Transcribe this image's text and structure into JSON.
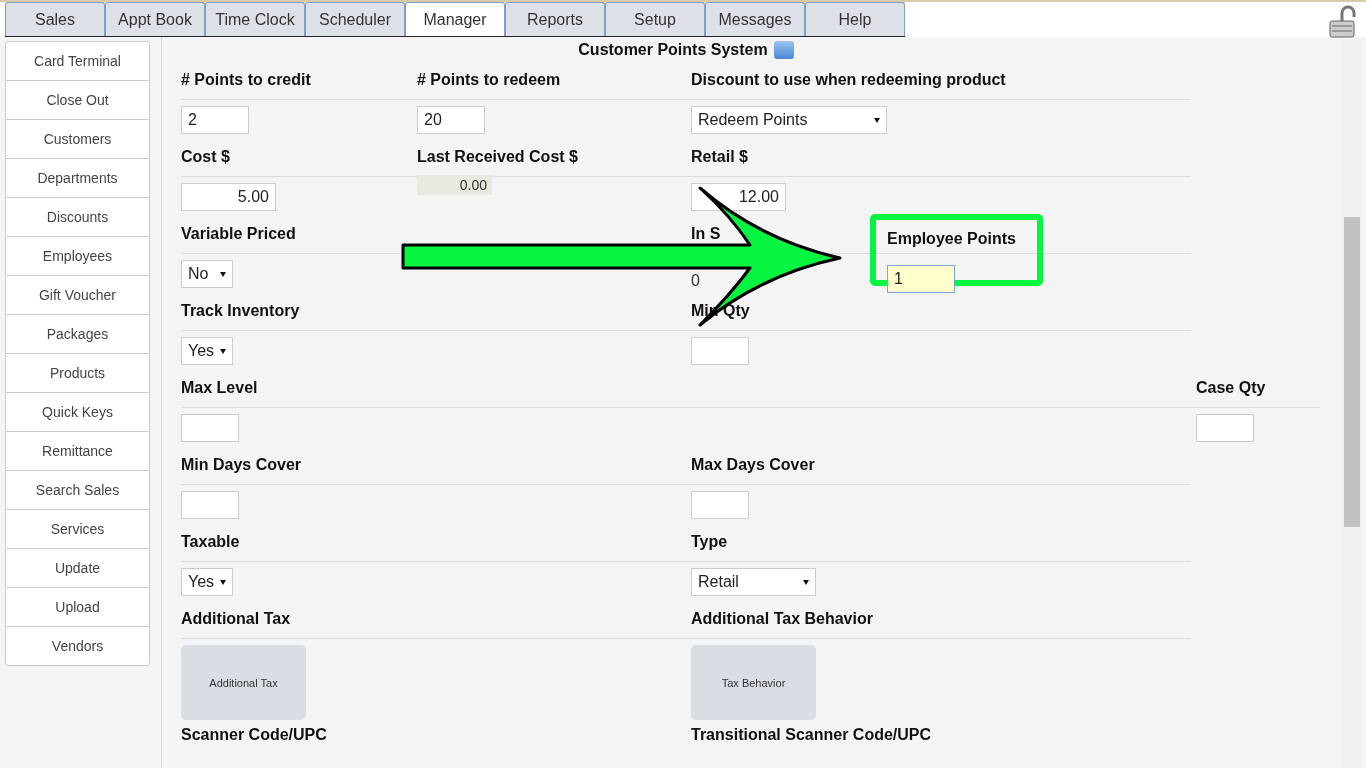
{
  "tabs": [
    {
      "label": "Sales",
      "selected": false
    },
    {
      "label": "Appt Book",
      "selected": false
    },
    {
      "label": "Time Clock",
      "selected": false
    },
    {
      "label": "Scheduler",
      "selected": false
    },
    {
      "label": "Manager",
      "selected": true
    },
    {
      "label": "Reports",
      "selected": false
    },
    {
      "label": "Setup",
      "selected": false
    },
    {
      "label": "Messages",
      "selected": false
    },
    {
      "label": "Help",
      "selected": false
    }
  ],
  "sidebar": {
    "items": [
      "Card Terminal",
      "Close Out",
      "Customers",
      "Departments",
      "Discounts",
      "Employees",
      "Gift Voucher",
      "Packages",
      "Products",
      "Quick Keys",
      "Remittance",
      "Search Sales",
      "Services",
      "Update",
      "Upload",
      "Vendors"
    ]
  },
  "form": {
    "title": "Customer Points System",
    "rows": [
      {
        "fields": [
          {
            "label": "# Points to credit",
            "kind": "input",
            "value": "2",
            "highlighted": false
          },
          {
            "label": "# Points to redeem",
            "kind": "input",
            "value": "20",
            "highlighted": false
          },
          {
            "label": "Discount to use when redeeming product",
            "kind": "select",
            "value": "Redeem Points",
            "highlighted": false
          }
        ]
      },
      {
        "fields": [
          {
            "label": "Cost $",
            "kind": "money",
            "value": "5.00",
            "highlighted": false
          },
          {
            "label": "Last Received Cost $",
            "kind": "readonly",
            "value": "0.00",
            "highlighted": false
          },
          {
            "label": "Retail $",
            "kind": "money",
            "value": "12.00",
            "highlighted": false
          }
        ]
      },
      {
        "fields": [
          {
            "label": "Variable Priced",
            "kind": "select",
            "value": "No",
            "highlighted": false
          },
          {
            "label": "In S",
            "kind": "plain",
            "value": "0",
            "highlighted": false
          },
          {
            "label": "Employee Points",
            "kind": "input",
            "value": "1",
            "highlighted": true
          }
        ]
      },
      {
        "fields": [
          {
            "label": "Track Inventory",
            "kind": "select",
            "value": "Yes",
            "highlighted": false
          },
          {
            "label": "Min Qty",
            "kind": "input",
            "highlighted": false
          }
        ]
      },
      {
        "fields": [
          {
            "label": "Max Level",
            "kind": "input",
            "highlighted": false
          },
          {
            "label": "Case Qty",
            "kind": "input",
            "highlighted": false
          }
        ]
      },
      {
        "fields": [
          {
            "label": "Min Days Cover",
            "kind": "input",
            "highlighted": false
          },
          {
            "label": "Max Days Cover",
            "kind": "input",
            "highlighted": false
          }
        ]
      },
      {
        "fields": [
          {
            "label": "Taxable",
            "kind": "select",
            "value": "Yes",
            "highlighted": false
          },
          {
            "label": "Type",
            "kind": "select",
            "value": "Retail",
            "highlighted": false
          }
        ]
      },
      {
        "fields": [
          {
            "label": "Additional Tax",
            "kind": "button",
            "value": "Additional Tax",
            "highlighted": false
          },
          {
            "label": "Additional Tax Behavior",
            "kind": "button",
            "value": "Tax Behavior",
            "highlighted": false
          }
        ]
      },
      {
        "fields": [
          {
            "label": "Scanner Code/UPC",
            "kind": "none",
            "highlighted": false
          },
          {
            "label": "Transitional Scanner Code/UPC",
            "kind": "none",
            "highlighted": false
          }
        ]
      }
    ]
  },
  "annotation": {
    "kind": "arrow"
  }
}
